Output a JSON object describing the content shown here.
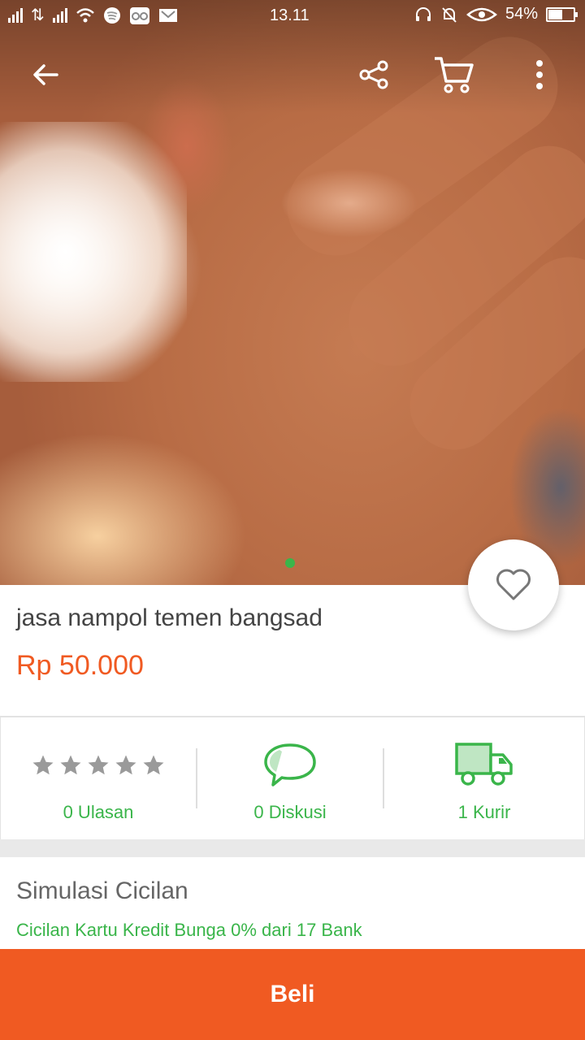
{
  "status_bar": {
    "time": "13.11",
    "battery_percent": "54%",
    "battery_level": 0.54
  },
  "nav": {
    "back_icon": "arrow-left-icon",
    "share_icon": "share-icon",
    "cart_icon": "cart-icon",
    "menu_icon": "more-vertical-icon"
  },
  "product": {
    "title": "jasa nampol temen bangsad",
    "price": "Rp 50.000",
    "image_count": 1,
    "active_image": 1
  },
  "stats": {
    "reviews_label": "0 Ulasan",
    "discussions_label": "0 Diskusi",
    "couriers_label": "1 Kurir",
    "rating": 0
  },
  "installment": {
    "title": "Simulasi Cicilan",
    "subtitle": "Cicilan Kartu Kredit Bunga 0% dari 17 Bank"
  },
  "actions": {
    "buy_label": "Beli"
  },
  "colors": {
    "accent_orange": "#f05a22",
    "accent_green": "#3ab54a"
  }
}
